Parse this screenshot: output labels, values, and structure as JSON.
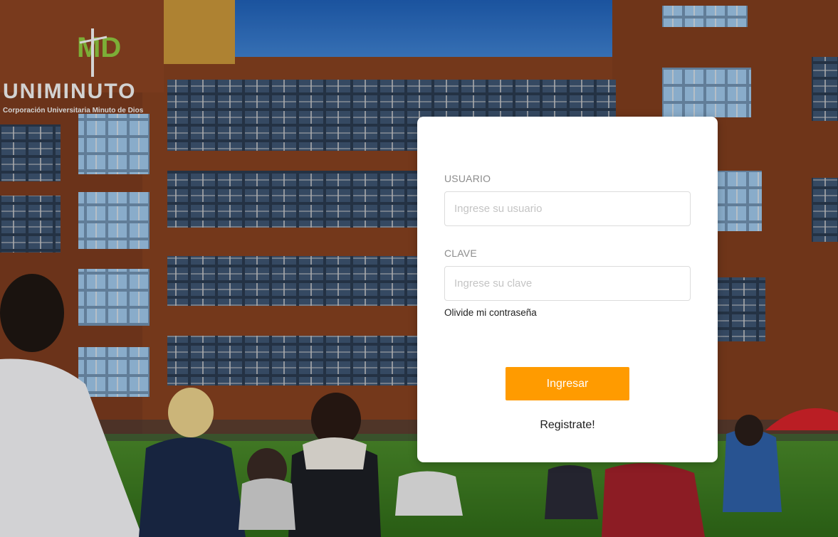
{
  "background": {
    "logo_mark": "MD",
    "logo_name": "UNIMINUTO",
    "logo_tagline": "Corporación Universitaria Minuto de Dios"
  },
  "login": {
    "user_label": "USUARIO",
    "user_placeholder": "Ingrese su usuario",
    "user_value": "",
    "pass_label": "CLAVE",
    "pass_placeholder": "Ingrese su clave",
    "pass_value": "",
    "forgot_label": "Olivide mi contraseña",
    "submit_label": "Ingresar",
    "register_label": "Registrate!"
  },
  "colors": {
    "accent": "#ff9b00",
    "card": "#ffffff",
    "label": "#8c8c8c"
  }
}
